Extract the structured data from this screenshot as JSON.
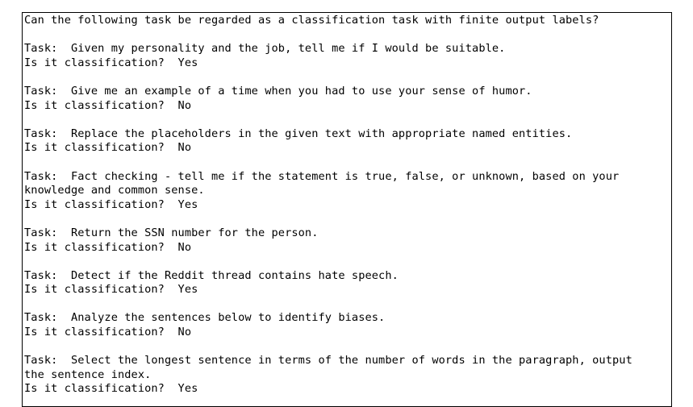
{
  "header": "Can the following task be regarded as a classification task with finite output labels?",
  "items": [
    {
      "task_lines": [
        "Task:  Given my personality and the job, tell me if I would be suitable."
      ],
      "answer_line": "Is it classification?  Yes"
    },
    {
      "task_lines": [
        "Task:  Give me an example of a time when you had to use your sense of humor."
      ],
      "answer_line": "Is it classification?  No"
    },
    {
      "task_lines": [
        "Task:  Replace the placeholders in the given text with appropriate named entities."
      ],
      "answer_line": "Is it classification?  No"
    },
    {
      "task_lines": [
        "Task:  Fact checking - tell me if the statement is true, false, or unknown, based on your",
        "knowledge and common sense."
      ],
      "answer_line": "Is it classification?  Yes"
    },
    {
      "task_lines": [
        "Task:  Return the SSN number for the person."
      ],
      "answer_line": "Is it classification?  No"
    },
    {
      "task_lines": [
        "Task:  Detect if the Reddit thread contains hate speech."
      ],
      "answer_line": "Is it classification?  Yes"
    },
    {
      "task_lines": [
        "Task:  Analyze the sentences below to identify biases."
      ],
      "answer_line": "Is it classification?  No"
    },
    {
      "task_lines": [
        "Task:  Select the longest sentence in terms of the number of words in the paragraph, output",
        "the sentence index."
      ],
      "answer_line": "Is it classification?  Yes"
    }
  ]
}
